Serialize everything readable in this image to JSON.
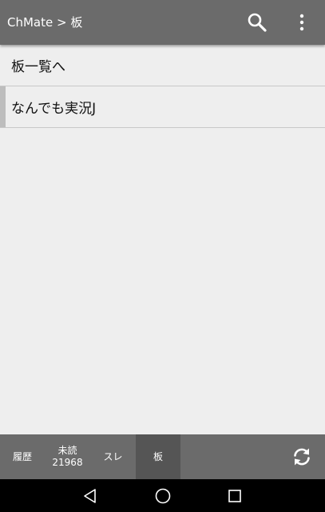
{
  "appbar": {
    "title": "ChMate > 板",
    "icons": [
      "search-icon",
      "more-vert-icon"
    ]
  },
  "list": {
    "items": [
      {
        "label": "板一覧へ",
        "selected": false
      },
      {
        "label": "なんでも実況J",
        "selected": true
      }
    ]
  },
  "bottom_tabs": {
    "history": {
      "label": "履歴"
    },
    "unread": {
      "label": "未読",
      "count": "21968"
    },
    "thread": {
      "label": "スレ"
    },
    "board": {
      "label": "板",
      "active": true
    },
    "refresh_icon": "refresh-icon"
  },
  "navbar": {
    "icons": [
      "back-icon",
      "home-icon",
      "recents-icon"
    ]
  },
  "colors": {
    "appbar": "#6b6b6b",
    "content_bg": "#eeeeee",
    "active_tab": "#555555",
    "selected_marker": "#bdbdbd",
    "navbar": "#000000"
  }
}
